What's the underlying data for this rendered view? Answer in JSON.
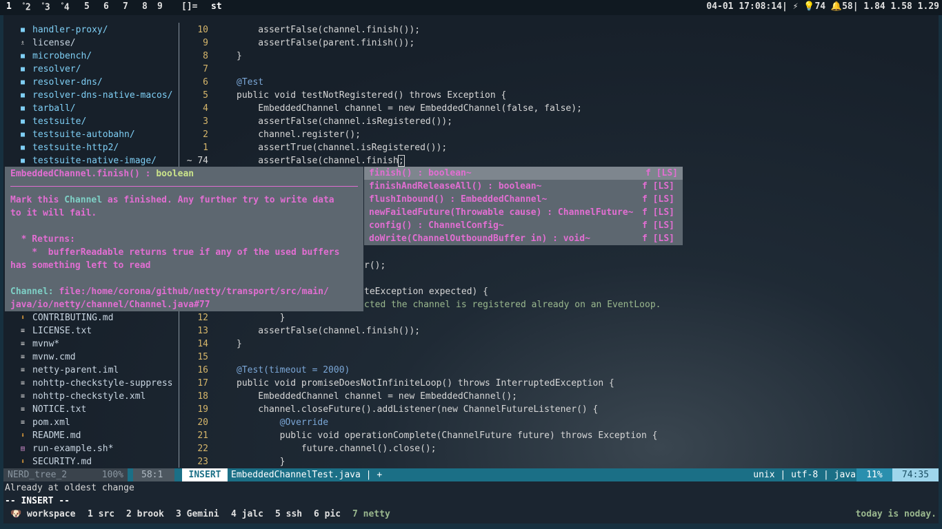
{
  "topbar": {
    "workspaces": [
      {
        "label": "1",
        "sup": ""
      },
      {
        "label": "2",
        "sup": "⁰"
      },
      {
        "label": "3",
        "sup": "⁰"
      },
      {
        "label": "4",
        "sup": "⁰"
      },
      {
        "label": "5",
        "sup": ""
      },
      {
        "label": "6",
        "sup": ""
      },
      {
        "label": "7",
        "sup": ""
      },
      {
        "label": "8",
        "sup": ""
      },
      {
        "label": "9",
        "sup": ""
      }
    ],
    "layout": "[]=",
    "window_title": "st",
    "status": "04-01 17:08:14| ⚡ 💡74 🔔58| 1.84 1.58 1.29"
  },
  "tree": {
    "items": [
      {
        "icon": "folder-icon",
        "label": "handler-proxy/",
        "dir": true
      },
      {
        "icon": "license-icon",
        "label": "license/",
        "dir": false
      },
      {
        "icon": "folder-icon",
        "label": "microbench/",
        "dir": true
      },
      {
        "icon": "folder-icon",
        "label": "resolver/",
        "dir": true
      },
      {
        "icon": "folder-icon",
        "label": "resolver-dns/",
        "dir": true
      },
      {
        "icon": "folder-icon",
        "label": "resolver-dns-native-macos/",
        "dir": true
      },
      {
        "icon": "folder-icon",
        "label": "tarball/",
        "dir": true
      },
      {
        "icon": "folder-icon",
        "label": "testsuite/",
        "dir": true
      },
      {
        "icon": "folder-icon",
        "label": "testsuite-autobahn/",
        "dir": true
      },
      {
        "icon": "folder-icon",
        "label": "testsuite-http2/",
        "dir": true
      },
      {
        "icon": "folder-icon",
        "label": "testsuite-native-image/",
        "dir": true
      }
    ],
    "items_bottom": [
      {
        "icon": "markdown-icon",
        "label": "CONTRIBUTING.md"
      },
      {
        "icon": "text-file-icon",
        "label": "LICENSE.txt"
      },
      {
        "icon": "text-file-icon",
        "label": "mvnw*"
      },
      {
        "icon": "text-file-icon",
        "label": "mvnw.cmd"
      },
      {
        "icon": "text-file-icon",
        "label": "netty-parent.iml"
      },
      {
        "icon": "text-file-icon",
        "label": "nohttp-checkstyle-suppress"
      },
      {
        "icon": "text-file-icon",
        "label": "nohttp-checkstyle.xml"
      },
      {
        "icon": "text-file-icon",
        "label": "NOTICE.txt"
      },
      {
        "icon": "text-file-icon",
        "label": "pom.xml"
      },
      {
        "icon": "markdown-icon",
        "label": "README.md"
      },
      {
        "icon": "shell-file-icon",
        "label": "run-example.sh*"
      },
      {
        "icon": "markdown-icon",
        "label": "SECURITY.md"
      }
    ]
  },
  "editor": {
    "lines_top": [
      {
        "n": "10",
        "code": "    assertFalse(channel.finish());"
      },
      {
        "n": "9",
        "code": "    assertFalse(parent.finish());"
      },
      {
        "n": "8",
        "code": "}"
      },
      {
        "n": "7",
        "code": ""
      },
      {
        "n": "6",
        "code": "@Test"
      },
      {
        "n": "5",
        "code": "public void testNotRegistered() throws Exception {"
      },
      {
        "n": "4",
        "code": "    EmbeddedChannel channel = new EmbeddedChannel(false, false);"
      },
      {
        "n": "3",
        "code": "    assertFalse(channel.isRegistered());"
      },
      {
        "n": "2",
        "code": "    channel.register();"
      },
      {
        "n": "1",
        "code": "    assertTrue(channel.isRegistered());"
      },
      {
        "n": "~ 74",
        "code": "    assertFalse(channel.finish"
      }
    ],
    "partial_lines": [
      {
        "code": "r();"
      },
      {
        "code": "teException expected) {"
      },
      {
        "code": "cted the channel is registered already on an EventLoop."
      }
    ],
    "lines_bottom": [
      {
        "n": "12",
        "code": "        }"
      },
      {
        "n": "13",
        "code": "    assertFalse(channel.finish());"
      },
      {
        "n": "14",
        "code": "}"
      },
      {
        "n": "15",
        "code": ""
      },
      {
        "n": "16",
        "code": "@Test(timeout = 2000)"
      },
      {
        "n": "17",
        "code": "public void promiseDoesNotInfiniteLoop() throws InterruptedException {"
      },
      {
        "n": "18",
        "code": "    EmbeddedChannel channel = new EmbeddedChannel();"
      },
      {
        "n": "19",
        "code": "    channel.closeFuture().addListener(new ChannelFutureListener() {"
      },
      {
        "n": "20",
        "code": "        @Override"
      },
      {
        "n": "21",
        "code": "        public void operationComplete(ChannelFuture future) throws Exception {"
      },
      {
        "n": "22",
        "code": "            future.channel().close();"
      },
      {
        "n": "23",
        "code": "        }"
      }
    ]
  },
  "doc_popup": {
    "signature": "EmbeddedChannel.finish() : ",
    "return_type": "boolean",
    "desc1_a": "Mark this ",
    "desc1_b": "Channel",
    "desc1_c": " as finished. Any further try to write data",
    "desc2": "to it will fail.",
    "returns_label": "  * Returns:",
    "returns1": "    *  bufferReadable returns true if any of the used buffers",
    "returns2": "has something left to read",
    "link_label": "Channel:",
    "link1": " file:/home/corona/github/netty/transport/src/main/",
    "link2": "java/io/netty/channel/Channel.java#77"
  },
  "completion": {
    "items": [
      {
        "label": "finish() : boolean~",
        "kind": "f [LS]",
        "selected": true
      },
      {
        "label": "finishAndReleaseAll() : boolean~",
        "kind": "f [LS]",
        "selected": false
      },
      {
        "label": "flushInbound() : EmbeddedChannel~",
        "kind": "f [LS]",
        "selected": false
      },
      {
        "label": "newFailedFuture(Throwable cause) : ChannelFuture~",
        "kind": "f [LS]",
        "selected": false
      },
      {
        "label": "config() : ChannelConfig~",
        "kind": "f [LS]",
        "selected": false
      },
      {
        "label": "doWrite(ChannelOutboundBuffer in) : void~",
        "kind": "f [LS]",
        "selected": false
      }
    ]
  },
  "statusline": {
    "tree_name": "NERD_tree_2",
    "tree_pct": "100%",
    "tree_pos": "58:1",
    "mode": "INSERT",
    "file": "EmbeddedChannelTest.java | +",
    "enc": "unix | utf-8 | java",
    "pct": "11%",
    "pos": "74:35"
  },
  "messages": {
    "line1": "Already at oldest change",
    "line2": "-- INSERT --"
  },
  "tmux": {
    "windows": [
      {
        "label": "workspace",
        "prefix": "🐶 "
      },
      {
        "label": "1 src"
      },
      {
        "label": "2 brook"
      },
      {
        "label": "3 Gemini"
      },
      {
        "label": "4 jalc"
      },
      {
        "label": "5 ssh"
      },
      {
        "label": "6 pic"
      },
      {
        "label": "7 netty"
      }
    ],
    "right": "today is noday."
  }
}
